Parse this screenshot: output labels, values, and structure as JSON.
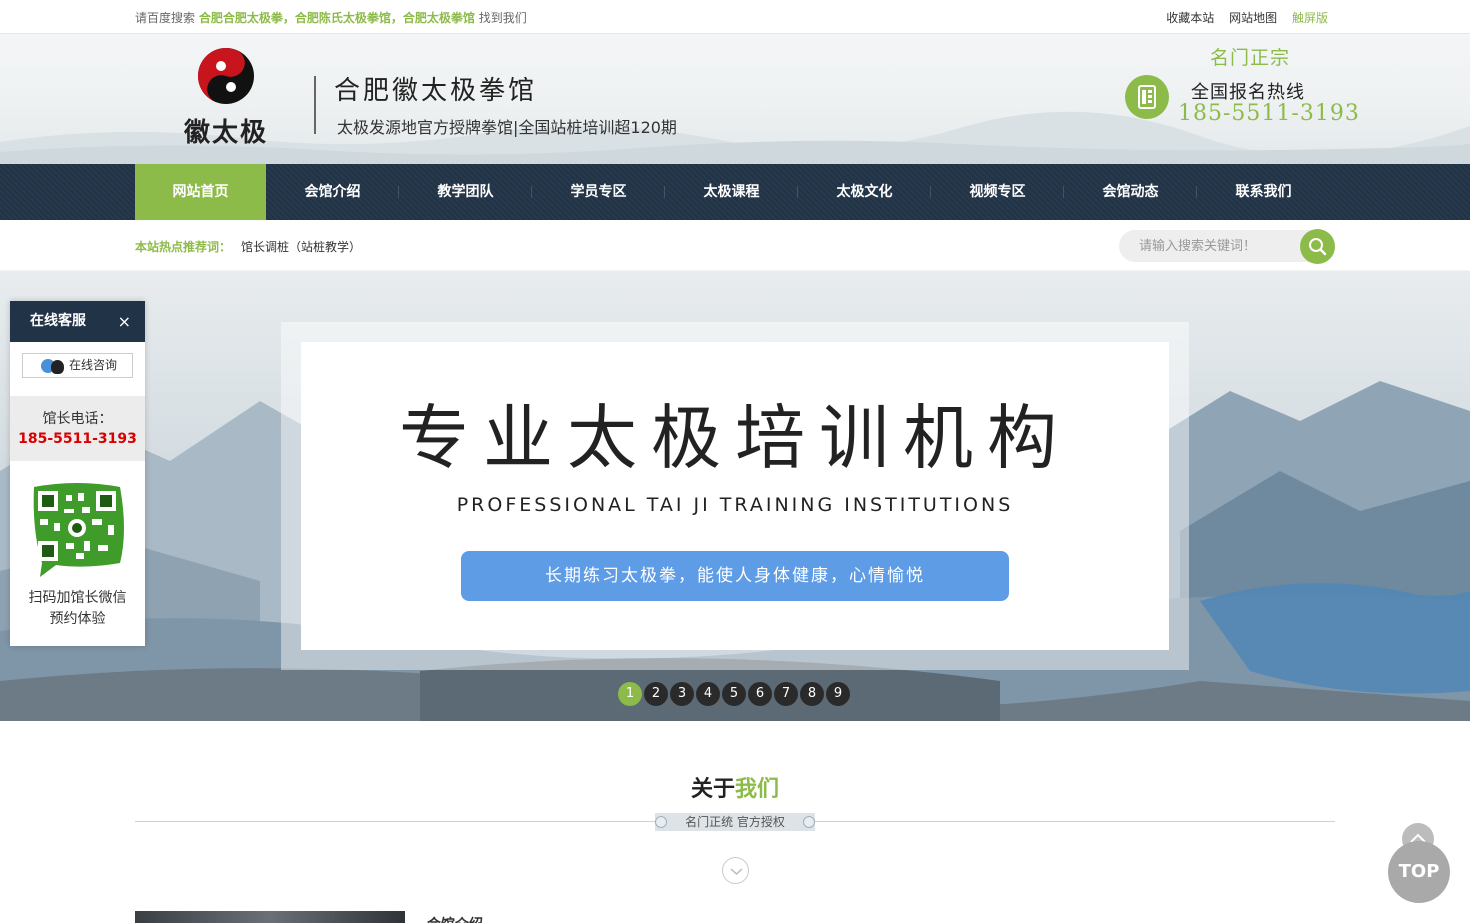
{
  "topbar": {
    "prefix": "请百度搜索",
    "keywords": "合肥合肥太极拳，合肥陈氏太极拳馆，合肥太极拳馆",
    "suffix": "找到我们",
    "links": [
      "收藏本站",
      "网站地图",
      "触屏版"
    ]
  },
  "header": {
    "logo_text": "徽太极",
    "site_title": "合肥徽太极拳馆",
    "site_subtitle": "太极发源地官方授牌拳馆|全国站桩培训超120期",
    "motto": "名门正宗",
    "hotline_label": "全国报名热线",
    "hotline_number": "185-5511-3193"
  },
  "nav": {
    "items": [
      {
        "label": "网站首页",
        "active": true
      },
      {
        "label": "会馆介绍",
        "active": false
      },
      {
        "label": "教学团队",
        "active": false
      },
      {
        "label": "学员专区",
        "active": false
      },
      {
        "label": "太极课程",
        "active": false
      },
      {
        "label": "太极文化",
        "active": false
      },
      {
        "label": "视频专区",
        "active": false
      },
      {
        "label": "会馆动态",
        "active": false
      },
      {
        "label": "联系我们",
        "active": false
      }
    ]
  },
  "hot": {
    "label": "本站热点推荐词：",
    "word": "馆长调桩（站桩教学）"
  },
  "search": {
    "placeholder": "请输入搜索关键词！"
  },
  "banner": {
    "title": "专业太极培训机构",
    "subtitle_en": "PROFESSIONAL TAI JI TRAINING INSTITUTIONS",
    "button": "长期练习太极拳，能使人身体健康，心情愉悦",
    "dots": [
      "1",
      "2",
      "3",
      "4",
      "5",
      "6",
      "7",
      "8",
      "9"
    ],
    "active_dot": 1
  },
  "service": {
    "title": "在线客服",
    "close": "×",
    "qq_label": "在线咨询",
    "tel_label": "馆长电话：",
    "tel_number": "185-5511-3193",
    "qr_caption_line1": "扫码加馆长微信",
    "qr_caption_line2": "预约体验"
  },
  "about": {
    "title_a": "关于",
    "title_b": "我们",
    "subtitle": "名门正统 官方授权",
    "item_title": "会馆介绍"
  },
  "top_button": {
    "label": "TOP"
  },
  "colors": {
    "accent": "#8dbb4a",
    "nav_bg": "#213346",
    "banner_button": "#5f9ce6",
    "tel_red": "#d90000"
  }
}
